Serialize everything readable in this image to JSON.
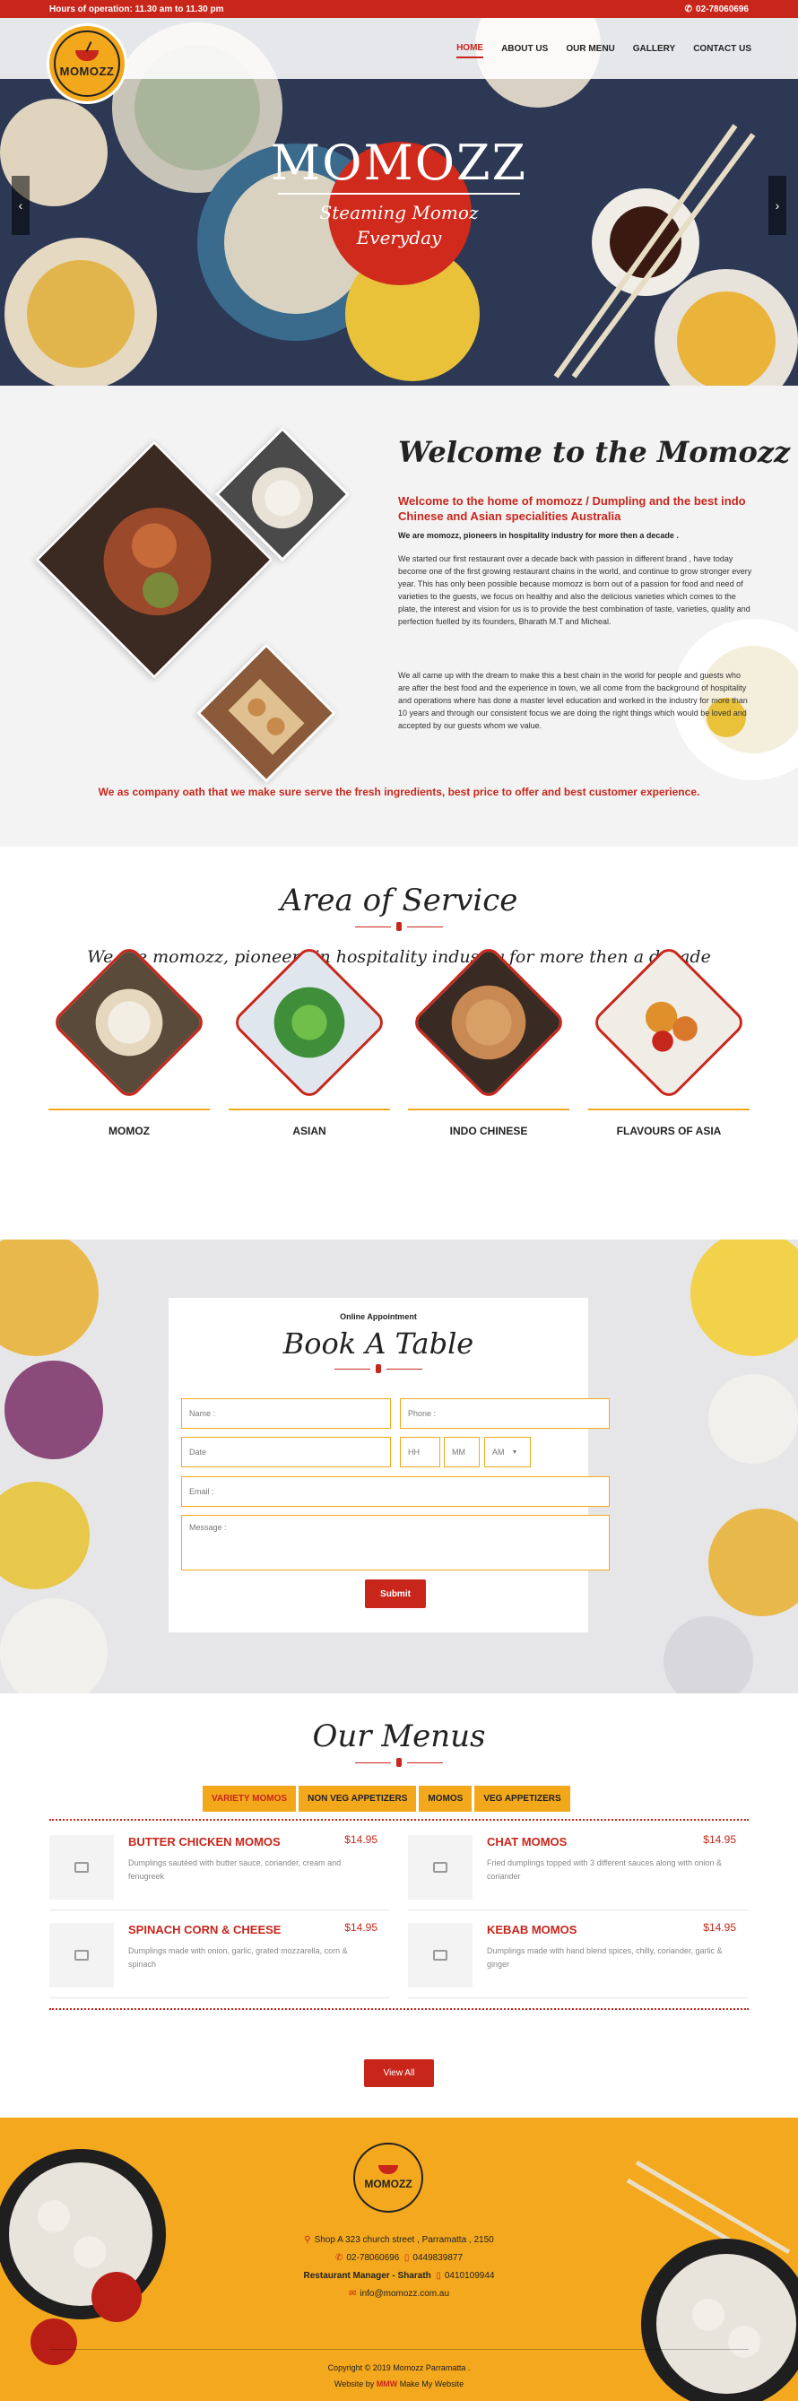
{
  "topbar": {
    "hours": "Hours of operation: 11.30 am to 11.30 pm",
    "phone": "02-78060696"
  },
  "brand": {
    "logo_text": "MOMOZZ",
    "accent": "#c8261b",
    "gold": "#f3a81c"
  },
  "nav": [
    "HOME",
    "ABOUT US",
    "OUR MENU",
    "GALLERY",
    "CONTACT US"
  ],
  "hero": {
    "title": "MOMOZZ",
    "subtitle_line1": "Steaming Momoz",
    "subtitle_line2": "Everyday",
    "prev": "‹",
    "next": "›"
  },
  "welcome": {
    "heading": "Welcome to the Momozz",
    "lead": "Welcome to the home of momozz / Dumpling and the best indo Chinese and Asian specialities Australia",
    "strong": "We are momozz, pioneers in hospitality industry for more then a decade .",
    "para1": "We started our first restaurant over a decade back with passion in different brand , have today become one of the first growing restaurant chains in the world, and continue to grow stronger every year. This has only been possible because momozz is born out of a passion for food and need of varieties to the guests, we focus on healthy and also the delicious varieties which comes to the plate, the interest and vision for us is to provide the best combination of taste, varieties, quality and perfection fuelled by its founders, Bharath M.T and Micheal.",
    "para2": "We all came up with the dream to make this a best chain in the world for people and guests who are after the best food and the experience in town, we all come from the background of hospitality and operations where has done a master level education and worked in the industry for more than 10 years and through our consistent focus we are doing the right things which would be loved and accepted by our guests whom we value.",
    "oath": "We as company oath that we make sure serve the fresh ingredients, best price to offer and best customer experience."
  },
  "service": {
    "heading": "Area of Service",
    "subheading": "We are momozz, pioneers in hospitality industry for more then a decade",
    "items": [
      "MOMOZ",
      "ASIAN",
      "INDO CHINESE",
      "FLAVOURS OF ASIA"
    ]
  },
  "booking": {
    "small": "Online Appointment",
    "heading": "Book A Table",
    "name": "Name :",
    "phone": "Phone :",
    "date": "Date",
    "hh": "HH",
    "mm": "MM",
    "ampm": "AM",
    "email": "Email :",
    "message": "Message :",
    "submit": "Submit"
  },
  "menus": {
    "heading": "Our Menus",
    "tabs": [
      "VARIETY MOMOS",
      "NON VEG APPETIZERS",
      "MOMOS",
      "VEG APPETIZERS"
    ],
    "items": [
      {
        "name": "BUTTER CHICKEN MOMOS",
        "price": "$14.95",
        "desc": "Dumplings sautéed with butter sauce, coriander, cream and fenugreek"
      },
      {
        "name": "CHAT MOMOS",
        "price": "$14.95",
        "desc": "Fried dumplings topped with 3 different sauces along with onion & coriander"
      },
      {
        "name": "SPINACH CORN & CHEESE",
        "price": "$14.95",
        "desc": "Dumplings made with onion, garlic, grated mozzarella, corn & spinach"
      },
      {
        "name": "KEBAB MOMOS",
        "price": "$14.95",
        "desc": "Dumplings made with hand blend spices, chilly, coriander, garlic & ginger"
      }
    ],
    "view_all": "View All"
  },
  "footer": {
    "logo_text": "MOMOZZ",
    "address": "Shop A 323 church street , Parramatta , 2150",
    "phone1": "02-78060696",
    "phone2": "0449839877",
    "manager_label": "Restaurant Manager - Sharath",
    "manager_phone": "0410109944",
    "email": "info@momozz.com.au",
    "copyright": "Copyright © 2019 Momozz Parramatta .",
    "website_by": "Website by",
    "maker_logo": "MMW",
    "maker": "Make My Website"
  }
}
